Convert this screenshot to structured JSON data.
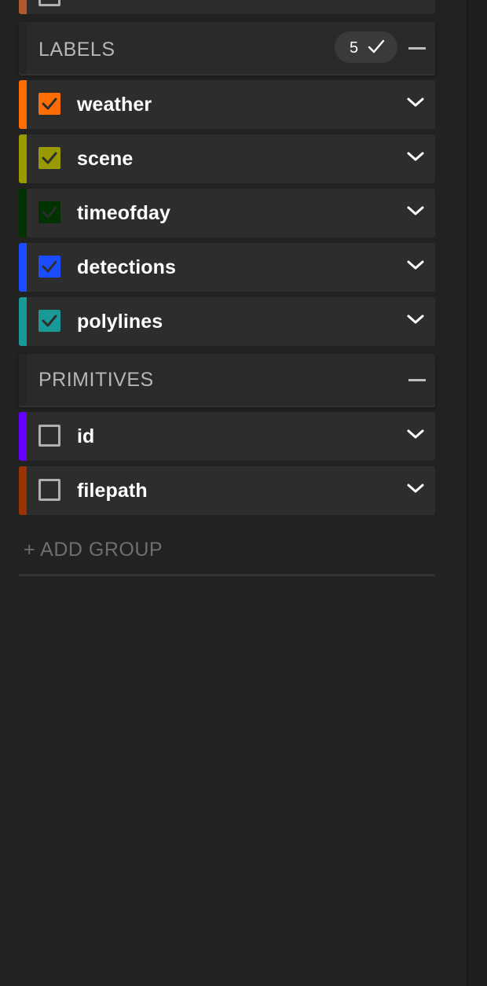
{
  "colors": {
    "background": "#222222",
    "row_bg": "#2d2d2d",
    "header_bg": "#2a2a2a"
  },
  "top_partial_row": {
    "color": "#b25a2e"
  },
  "labels_group": {
    "title": "LABELS",
    "count": "5",
    "collapse_icon": "minus-icon",
    "items": [
      {
        "label": "weather",
        "color": "#ff6d04",
        "checked": true
      },
      {
        "label": "scene",
        "color": "#999900",
        "checked": true
      },
      {
        "label": "timeofday",
        "color": "#003300",
        "checked": true
      },
      {
        "label": "detections",
        "color": "#1a4dff",
        "checked": true
      },
      {
        "label": "polylines",
        "color": "#1a9999",
        "checked": true
      }
    ]
  },
  "primitives_group": {
    "title": "PRIMITIVES",
    "collapse_icon": "minus-icon",
    "items": [
      {
        "label": "id",
        "color": "#6600ff",
        "checked": false
      },
      {
        "label": "filepath",
        "color": "#993300",
        "checked": false
      }
    ]
  },
  "add_group": {
    "label": "+ ADD GROUP"
  }
}
